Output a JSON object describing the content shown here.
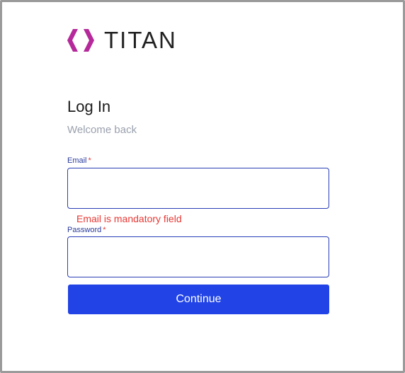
{
  "brand": {
    "name": "TITAN",
    "logo_icon": "chevron-brackets-icon",
    "accent_color": "#b5299a",
    "text_color": "#222222"
  },
  "login": {
    "title": "Log In",
    "subtitle": "Welcome back",
    "email": {
      "label": "Email",
      "required_mark": "*",
      "value": "",
      "error": "Email is mandatory field"
    },
    "password": {
      "label": "Password",
      "required_mark": "*",
      "value": ""
    },
    "continue_label": "Continue",
    "button_color": "#2244e6",
    "error_color": "#e53935",
    "field_border_color": "#2a3fb6"
  }
}
